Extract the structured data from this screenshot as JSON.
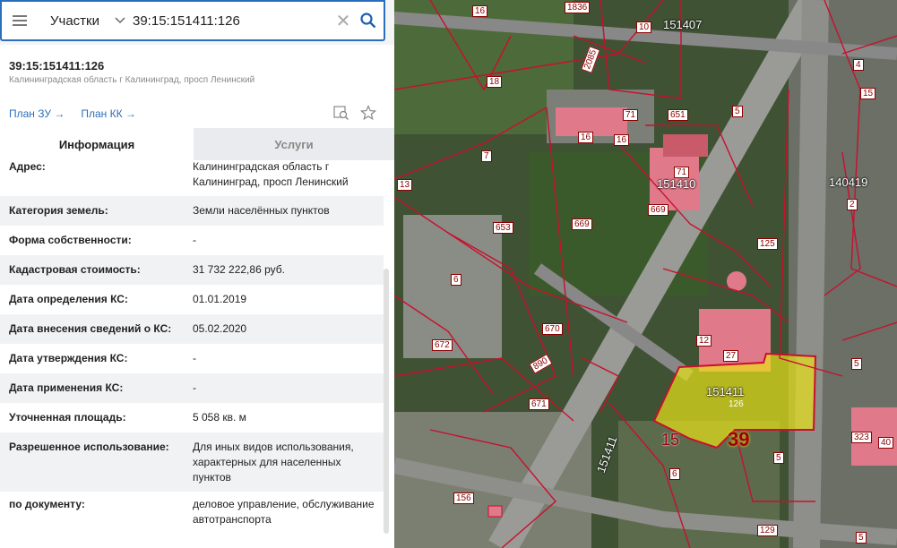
{
  "search": {
    "type_label": "Участки",
    "query": "39:15:151411:126"
  },
  "object": {
    "title": "39:15:151411:126",
    "address_sub": "Калининградская область г Калининград, просп Ленинский"
  },
  "links": {
    "plan_zu": "План ЗУ →",
    "plan_kk": "План КК →"
  },
  "tabs": [
    {
      "label": "Информация",
      "active": true
    },
    {
      "label": "Услуги",
      "active": false
    }
  ],
  "info": [
    {
      "key": "Адрес:",
      "value": "Калининградская область г Калининград, просп Ленинский"
    },
    {
      "key": "Категория земель:",
      "value": "Земли населённых пунктов"
    },
    {
      "key": "Форма собственности:",
      "value": "-"
    },
    {
      "key": "Кадастровая стоимость:",
      "value": "31 732 222,86 руб."
    },
    {
      "key": "Дата определения КС:",
      "value": "01.01.2019"
    },
    {
      "key": "Дата внесения сведений о КС:",
      "value": "05.02.2020"
    },
    {
      "key": "Дата утверждения КС:",
      "value": "-"
    },
    {
      "key": "Дата применения КС:",
      "value": "-"
    },
    {
      "key": "Уточненная площадь:",
      "value": "5 058 кв. м"
    },
    {
      "key": "Разрешенное использование:",
      "value": "Для иных видов использования, характерных для населенных пунктов"
    },
    {
      "key": "по документу:",
      "value": "деловое управление, обслуживание автотранспорта"
    }
  ],
  "map": {
    "labels": {
      "q151407": "151407",
      "q151410": "151410",
      "q140419": "140419",
      "q151411": "151411",
      "q151411_road": "151411",
      "p126": "126",
      "p39": "39",
      "p15": "15",
      "n1836": "1836",
      "n16a": "16",
      "n10": "10",
      "n2085": "2085",
      "n18": "18",
      "n16b": "16",
      "n71a": "71",
      "n16c": "16",
      "n651": "651",
      "n5a": "5",
      "n4": "4",
      "n7": "7",
      "n13": "13",
      "n71b": "71",
      "n669a": "669",
      "n669b": "669",
      "n653": "653",
      "n125": "125",
      "n6a": "6",
      "n12": "12",
      "n27": "27",
      "n670": "670",
      "n672": "672",
      "n890": "890",
      "n671": "671",
      "n5b": "5",
      "n323": "323",
      "n40": "40",
      "n6b": "6",
      "n5c": "5",
      "n156": "156",
      "n129": "129",
      "n5d": "5",
      "n2": "2",
      "n15": "15"
    },
    "colors": {
      "selected_fill": "#e8e21a",
      "boundary": "#c8102e",
      "building": "#e07a8a"
    }
  }
}
